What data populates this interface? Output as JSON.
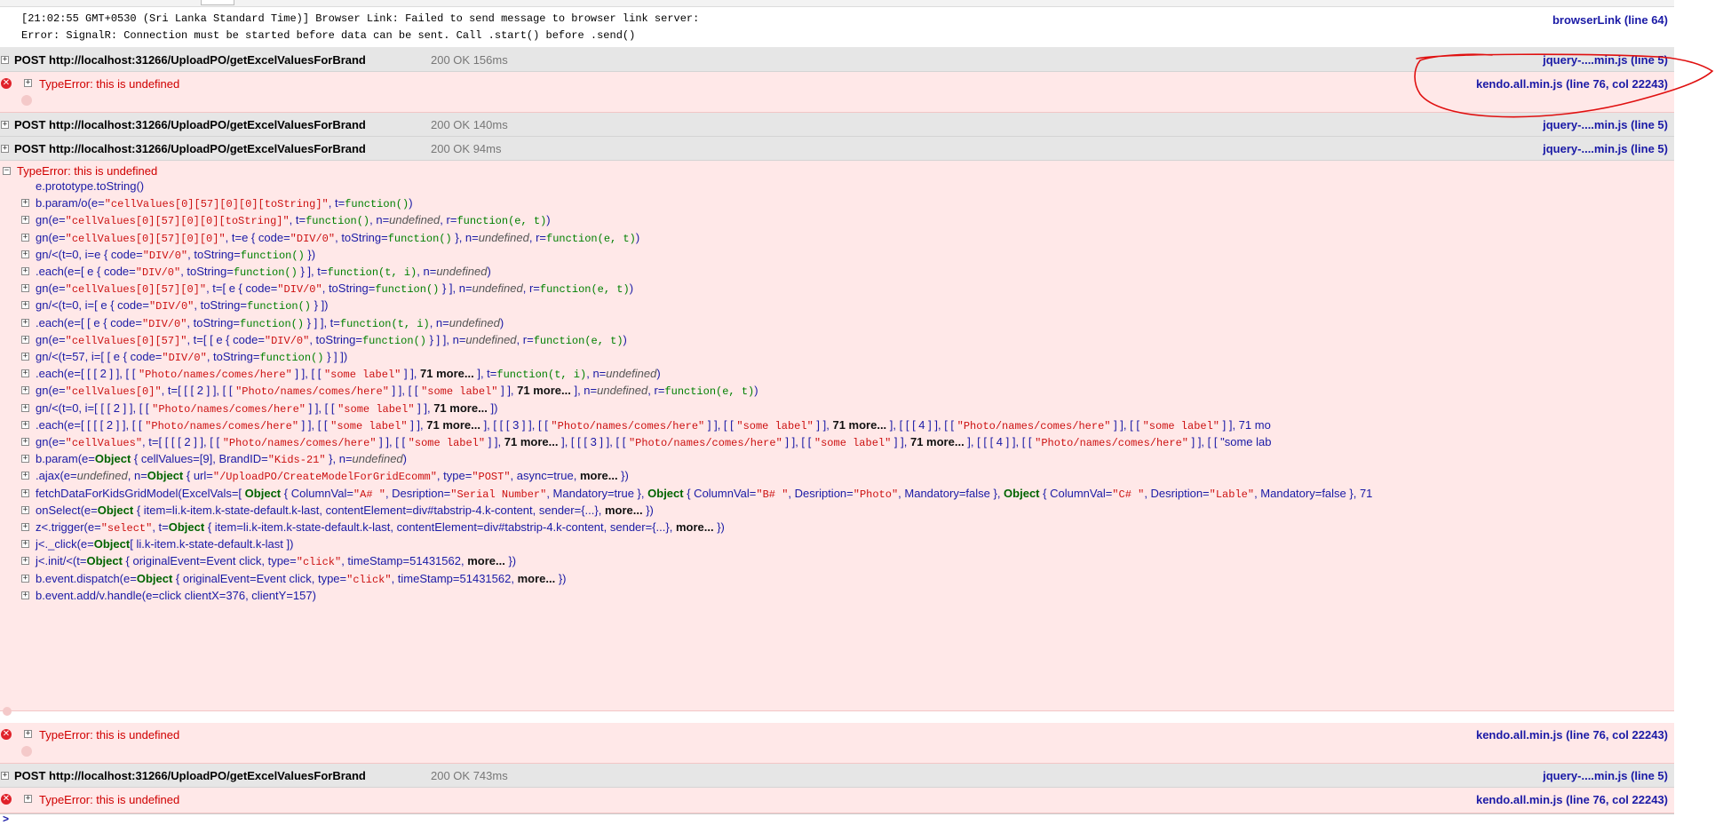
{
  "log": {
    "line1": "[21:02:55 GMT+0530 (Sri Lanka Standard Time)] Browser Link: Failed to send message to browser link server:",
    "line2": "Error: SignalR: Connection must be started before data can be sent. Call .start() before .send()",
    "source": "browserLink (line 64)"
  },
  "net_rows": [
    {
      "text": "POST http://localhost:31266/UploadPO/getExcelValuesForBrand",
      "status": "200 OK 156ms",
      "source": "jquery-....min.js (line 5)"
    },
    {
      "text": "POST http://localhost:31266/UploadPO/getExcelValuesForBrand",
      "status": "200 OK 140ms",
      "source": "jquery-....min.js (line 5)"
    },
    {
      "text": "POST http://localhost:31266/UploadPO/getExcelValuesForBrand",
      "status": "200 OK 94ms",
      "source": "jquery-....min.js (line 5)"
    },
    {
      "text": "POST http://localhost:31266/UploadPO/getExcelValuesForBrand",
      "status": "200 OK 743ms",
      "source": "jquery-....min.js (line 5)"
    }
  ],
  "errors": [
    {
      "message": "TypeError: this is undefined",
      "source": "kendo.all.min.js (line 76, col 22243)"
    },
    {
      "message": "TypeError: this is undefined",
      "source": "kendo.all.min.js (line 76, col 22243)"
    },
    {
      "message": "TypeError: this is undefined",
      "source": "kendo.all.min.js (line 76, col 22243)"
    }
  ],
  "stack": {
    "header": "TypeError: this is undefined",
    "frames": [
      "e.prototype.toString()",
      "b.param/o(e=\"cellValues[0][57][0][0][toString]\", t=function())",
      "gn(e=\"cellValues[0][57][0][0][toString]\", t=function(), n=undefined, r=function(e, t))",
      "gn(e=\"cellValues[0][57][0][0]\", t=e { code=\"DIV/0\", toString=function() }, n=undefined, r=function(e, t))",
      "gn/<(t=0, i=e { code=\"DIV/0\", toString=function() })",
      ".each(e=[ e { code=\"DIV/0\", toString=function() } ], t=function(t, i), n=undefined)",
      "gn(e=\"cellValues[0][57][0]\", t=[ e { code=\"DIV/0\", toString=function() } ], n=undefined, r=function(e, t))",
      "gn/<(t=0, i=[ e { code=\"DIV/0\", toString=function() } ])",
      ".each(e=[ [ e { code=\"DIV/0\", toString=function() } ] ], t=function(t, i), n=undefined)",
      "gn(e=\"cellValues[0][57]\", t=[ [ e { code=\"DIV/0\", toString=function() } ] ], n=undefined, r=function(e, t))",
      "gn/<(t=57, i=[ [ e { code=\"DIV/0\", toString=function() } ] ])",
      ".each(e=[ [ [ 2 ] ], [ [ \"Photo/names/comes/here\" ] ], [ [ \"some label\" ] ], 71 more... ], t=function(t, i), n=undefined)",
      "gn(e=\"cellValues[0]\", t=[ [ [ 2 ] ], [ [ \"Photo/names/comes/here\" ] ], [ [ \"some label\" ] ], 71 more... ], n=undefined, r=function(e, t))",
      "gn/<(t=0, i=[ [ [ 2 ] ], [ [ \"Photo/names/comes/here\" ] ], [ [ \"some label\" ] ], 71 more... ])",
      ".each(e=[ [ [ [ 2 ] ], [ [ \"Photo/names/comes/here\" ] ], [ [ \"some label\" ] ], 71 more... ], [ [ [ 3 ] ], [ [ \"Photo/names/comes/here\" ] ], [ [ \"some label\" ] ], 71 more... ], [ [ [ 4 ] ], [ [ \"Photo/names/comes/here\" ] ], [ [ \"some label\" ] ], 71 mo",
      "gn(e=\"cellValues\", t=[ [ [ [ 2 ] ], [ [ \"Photo/names/comes/here\" ] ], [ [ \"some label\" ] ], 71 more... ], [ [ [ 3 ] ], [ [ \"Photo/names/comes/here\" ] ], [ [ \"some label\" ] ], 71 more... ], [ [ [ 4 ] ], [ [ \"Photo/names/comes/here\" ] ], [ [ \"some lab",
      "b.param(e=Object { cellValues=[9], BrandID=\"Kids-21\" }, n=undefined)",
      ".ajax(e=undefined, n=Object { url=\"/UploadPO/CreateModelForGridEcomm\", type=\"POST\", async=true, more... })",
      "fetchDataForKidsGridModel(ExcelVals=[ Object { ColumnVal=\"A# \", Desription=\"Serial Number\", Mandatory=true }, Object { ColumnVal=\"B# \", Desription=\"Photo\", Mandatory=false }, Object { ColumnVal=\"C# \", Desription=\"Lable\", Mandatory=false }, 71",
      "onSelect(e=Object { item=li.k-item.k-state-default.k-last, contentElement=div#tabstrip-4.k-content, sender={...}, more... })",
      "z<.trigger(e=\"select\", t=Object { item=li.k-item.k-state-default.k-last, contentElement=div#tabstrip-4.k-content, sender={...}, more... })",
      "j<._click(e=Object[ li.k-item.k-state-default.k-last ])",
      "j<.init/<(t=Object { originalEvent=Event click, type=\"click\", timeStamp=51431562, more... })",
      "b.event.dispatch(e=Object { originalEvent=Event click, type=\"click\", timeStamp=51431562, more... })",
      "b.event.add/v.handle(e=click clientX=376, clientY=157)"
    ]
  },
  "colors": {
    "error_bg": "#ffe8e8",
    "net_bg": "#e6e6e6",
    "link": "#1a1aa6",
    "error_text": "#d00000",
    "annotation": "#e01010"
  },
  "icons": {
    "error": "error-x-icon",
    "expand": "expand-plus-icon",
    "collapse": "collapse-minus-icon"
  },
  "command_prompt": ">"
}
